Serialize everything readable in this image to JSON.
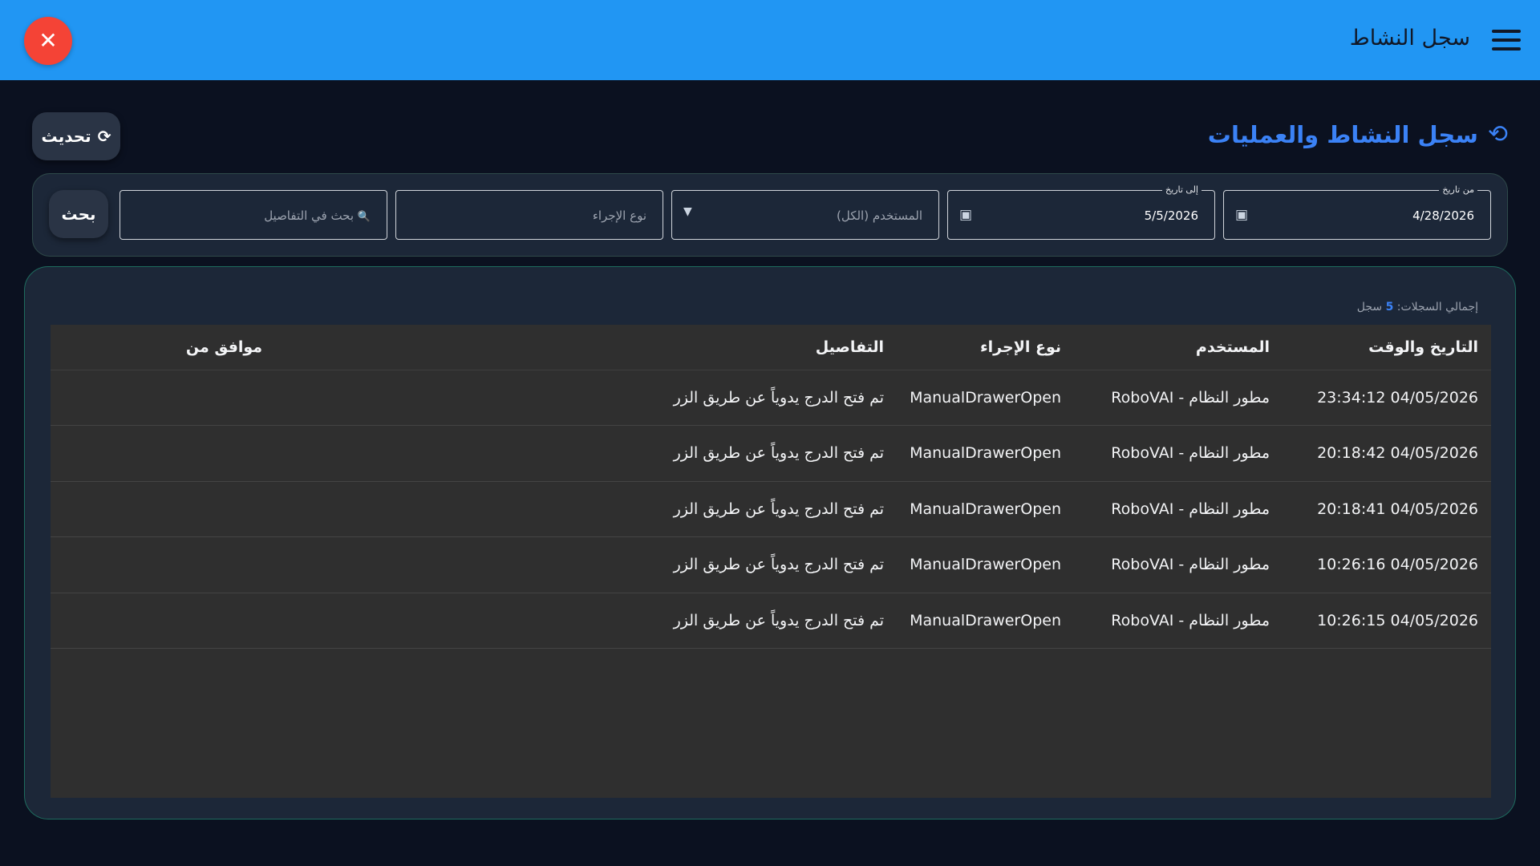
{
  "appbar": {
    "title": "سجل النشاط",
    "close_symbol": "✕",
    "accent": "#2196f3",
    "close_color": "#f44336"
  },
  "header": {
    "title": "سجل النشاط والعمليات",
    "refresh_label": "تحديث",
    "refresh_icon": "⟳",
    "history_icon": "⟲"
  },
  "filters": {
    "from_date": {
      "legend": "من تاريخ",
      "value": "4/28/2026"
    },
    "to_date": {
      "legend": "إلى تاريخ",
      "value": "5/5/2026"
    },
    "user": {
      "placeholder": "المستخدم (الكل)"
    },
    "action_type": {
      "placeholder": "نوع الإجراء"
    },
    "details_search": {
      "placeholder": "بحث في التفاصيل"
    },
    "search_icon": "🔍",
    "calendar_icon": "▣",
    "dropdown_icon": "▼",
    "search_label": "بحث"
  },
  "results": {
    "total_label": "إجمالي السجلات:",
    "total_count": "5",
    "total_unit": "سجل",
    "columns": {
      "datetime": "التاريخ والوقت",
      "user": "المستخدم",
      "action": "نوع الإجراء",
      "details": "التفاصيل",
      "approved_by": "موافق من"
    },
    "rows": [
      {
        "datetime": "04/05/2026 23:34:12",
        "user": "مطور النظام - RoboVAI",
        "action": "ManualDrawerOpen",
        "details": "تم فتح الدرج يدوياً عن طريق الزر",
        "approved_by": ""
      },
      {
        "datetime": "04/05/2026 20:18:42",
        "user": "مطور النظام - RoboVAI",
        "action": "ManualDrawerOpen",
        "details": "تم فتح الدرج يدوياً عن طريق الزر",
        "approved_by": ""
      },
      {
        "datetime": "04/05/2026 20:18:41",
        "user": "مطور النظام - RoboVAI",
        "action": "ManualDrawerOpen",
        "details": "تم فتح الدرج يدوياً عن طريق الزر",
        "approved_by": ""
      },
      {
        "datetime": "04/05/2026 10:26:16",
        "user": "مطور النظام - RoboVAI",
        "action": "ManualDrawerOpen",
        "details": "تم فتح الدرج يدوياً عن طريق الزر",
        "approved_by": ""
      },
      {
        "datetime": "04/05/2026 10:26:15",
        "user": "مطور النظام - RoboVAI",
        "action": "ManualDrawerOpen",
        "details": "تم فتح الدرج يدوياً عن طريق الزر",
        "approved_by": ""
      }
    ]
  }
}
